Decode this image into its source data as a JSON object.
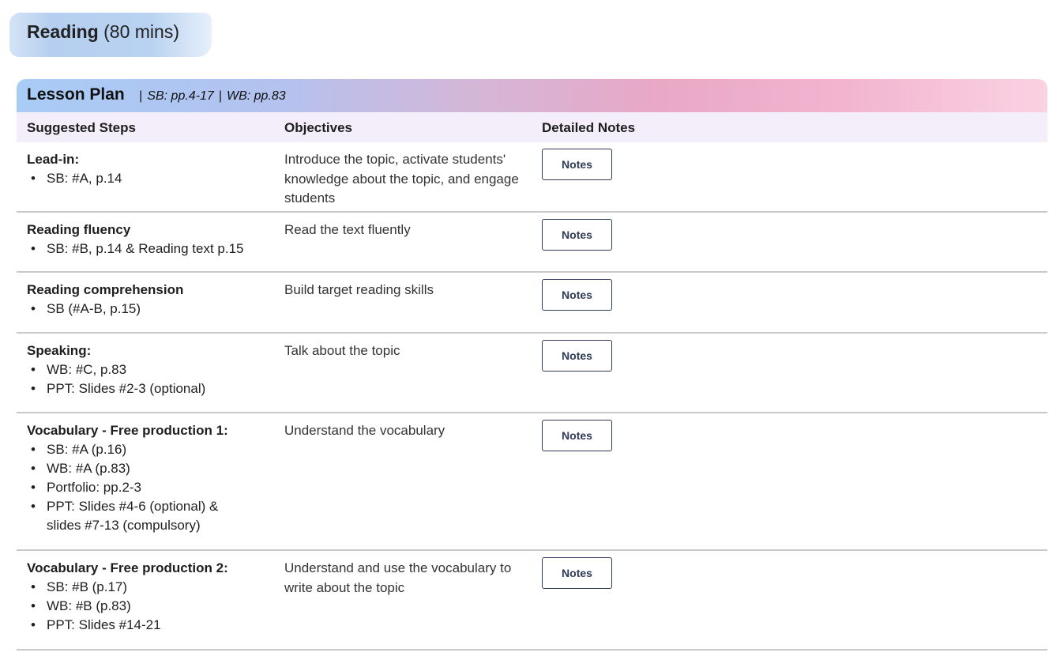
{
  "section": {
    "title_strong": "Reading",
    "title_rest": " (80 mins)"
  },
  "plan": {
    "title": "Lesson Plan",
    "sep": "|",
    "sb": "SB: pp.4-17",
    "wb": "WB: pp.83"
  },
  "columns": {
    "steps": "Suggested Steps",
    "objectives": "Objectives",
    "notes": "Detailed Notes"
  },
  "rows": [
    {
      "title": "Lead-in:",
      "items": [
        "SB: #A, p.14"
      ],
      "objective": "Introduce the topic, activate students' knowledge about the topic, and engage students",
      "button": "Notes"
    },
    {
      "title": "Reading fluency",
      "items": [
        "SB: #B, p.14 & Reading text p.15"
      ],
      "objective": "Read the text fluently",
      "button": "Notes"
    },
    {
      "title": "Reading comprehension",
      "items": [
        "SB (#A-B, p.15)"
      ],
      "objective": "Build target reading skills",
      "button": "Notes"
    },
    {
      "title": "Speaking:",
      "items": [
        "WB: #C, p.83",
        "PPT: Slides #2-3 (optional)"
      ],
      "objective": "Talk about the topic",
      "button": "Notes"
    },
    {
      "title": "Vocabulary - Free production 1:",
      "items": [
        "SB: #A (p.16)",
        "WB: #A (p.83)",
        "Portfolio: pp.2-3",
        "PPT: Slides #4-6 (optional) & slides #7-13 (compulsory)"
      ],
      "objective": "Understand the vocabulary",
      "button": "Notes"
    },
    {
      "title": "Vocabulary - Free production 2:",
      "items": [
        "SB: #B (p.17)",
        "WB: #B (p.83)",
        "PPT: Slides #14-21"
      ],
      "objective": "Understand and use the vocabulary to write about the topic",
      "button": "Notes"
    }
  ]
}
